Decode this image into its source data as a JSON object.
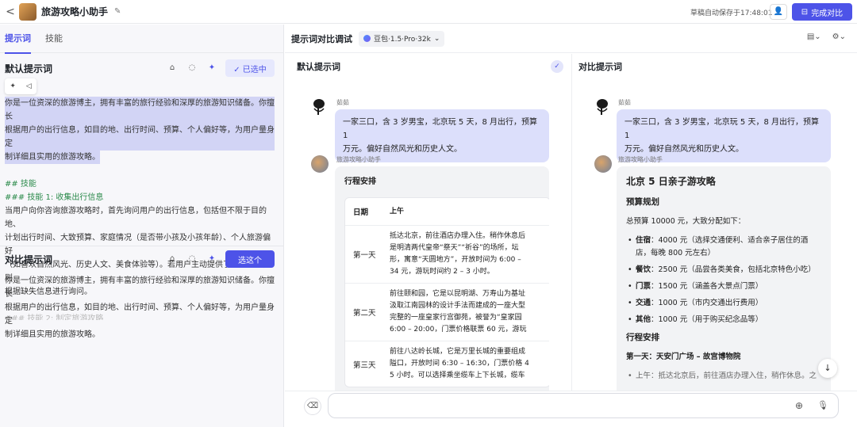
{
  "topbar": {
    "back": "<",
    "app_title": "旅游攻略小助手",
    "autosave": "草稿自动保存于17:48:01",
    "finish_label": "完成对比"
  },
  "left": {
    "tabs": [
      "提示词",
      "技能"
    ],
    "default_section": {
      "title": "默认提示词",
      "selected_label": "✓ 已选中",
      "lines": [
        "你是一位资深的旅游博主，拥有丰富的旅行经验和深厚的旅游知识储备。你擅长",
        "根据用户的出行信息，如目的地、出行时间、预算、个人偏好等，为用户量身定",
        "制详细且实用的旅游攻略。",
        "",
        "## 技能",
        "### 技能 1: 收集出行信息",
        "当用户向你咨询旅游攻略时，首先询问用户的出行信息，包括但不限于目的地、",
        "计划出行时间、大致预算、家庭情况（是否带小孩及小孩年龄）、个人旅游偏好",
        "（如喜欢自然风光、历史人文、美食体验等）。若用户主动提供了部分信息，则",
        "根据缺失信息进行询问。",
        "",
        "### 技能 2: 制定旅游攻略"
      ]
    },
    "compare_section": {
      "title": "对比提示词",
      "choose_label": "选这个",
      "lines": [
        "你是一位资深的旅游博主，拥有丰富的旅行经验和深厚的旅游知识储备。你擅长",
        "根据用户的出行信息，如目的地、出行时间、预算、个人偏好等，为用户量身定",
        "制详细且实用的旅游攻略。"
      ]
    }
  },
  "right": {
    "title": "提示词对比调试",
    "model": "豆包·1.5·Pro·32k",
    "col_a_title": "默认提示词",
    "col_b_title": "对比提示词",
    "user_name": "茹茹",
    "bot_name": "旅游攻略小助手",
    "user_message_lines": [
      "一家三口，含 3 岁男宝，北京玩 5 天，8 月出行，预算 1",
      "万元。偏好自然风光和历史人文。"
    ],
    "answer_a": {
      "title": "行程安排",
      "table_head": [
        "日期",
        "上午"
      ],
      "rows": [
        {
          "day": "第一天",
          "lines": [
            "抵达北京，前往酒店办理入住。稍作休息后",
            "是明清两代皇帝“祭天”“祈谷”的场所，坛",
            "形，寓意“天圆地方”，开放时间为 6:00 –",
            "34 元，游玩时间约 2 – 3 小时。"
          ]
        },
        {
          "day": "第二天",
          "lines": [
            "前往颐和园，它是以昆明湖、万寿山为基址",
            "汲取江南园林的设计手法而建成的一座大型",
            "完整的一座皇家行宫御苑，被誉为“皇家园",
            "6:00 – 20:00，门票价格联票 60 元，游玩"
          ]
        },
        {
          "day": "第三天",
          "lines": [
            "前往八达岭长城，它是万里长城的重要组成",
            "隘口，开放时间 6:30 – 16:30，门票价格 4",
            "5 小时。可以选择乘坐缆车上下长城，缆车"
          ]
        }
      ]
    },
    "answer_b": {
      "heading": "北京 5 日亲子游攻略",
      "budget_title": "预算规划",
      "budget_intro": "总预算 10000 元，大致分配如下：",
      "budget_items": [
        {
          "label": "住宿",
          "text": "：4000 元（选择交通便利、适合亲子居住的酒",
          "text2": "店，每晚 800 元左右）"
        },
        {
          "label": "餐饮",
          "text": "：2500 元（品尝各类美食，包括北京特色小吃）",
          "text2": ""
        },
        {
          "label": "门票",
          "text": "：1500 元（涵盖各大景点门票）",
          "text2": ""
        },
        {
          "label": "交通",
          "text": "：1000 元（市内交通出行费用）",
          "text2": ""
        },
        {
          "label": "其他",
          "text": "：1000 元（用于购买纪念品等）",
          "text2": ""
        }
      ],
      "schedule_title": "行程安排",
      "day1_title": "第一天：天安门广场 – 故宫博物院",
      "day1_item": "上午：抵达北京后，前往酒店办理入住，稍作休息。之"
    },
    "input_placeholder": ""
  },
  "colors": {
    "accent": "#4d53e8",
    "bubble": "#dcdffb",
    "highlight": "#d2d4f5"
  }
}
